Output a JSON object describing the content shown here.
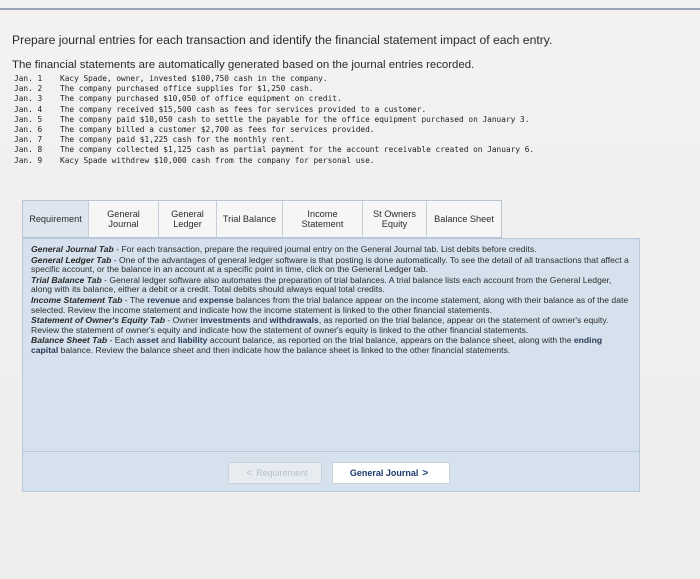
{
  "heading": "Prepare journal entries for each transaction and identify the financial statement impact of each entry.",
  "subheading": "The financial statements are automatically generated based on the journal entries recorded.",
  "transactions": [
    {
      "date": "Jan. 1",
      "text": "Kacy Spade, owner, invested $100,750 cash in the company."
    },
    {
      "date": "Jan. 2",
      "text": "The company purchased office supplies for $1,250 cash."
    },
    {
      "date": "Jan. 3",
      "text": "The company purchased $10,050 of office equipment on credit."
    },
    {
      "date": "Jan. 4",
      "text": "The company received $15,500 cash as fees for services provided to a customer."
    },
    {
      "date": "Jan. 5",
      "text": "The company paid $10,050 cash to settle the payable for the office equipment purchased on January 3."
    },
    {
      "date": "Jan. 6",
      "text": "The company billed a customer $2,700 as fees for services provided."
    },
    {
      "date": "Jan. 7",
      "text": "The company paid $1,225 cash for the monthly rent."
    },
    {
      "date": "Jan. 8",
      "text": "The company collected $1,125 cash as partial payment for the account receivable created on January 6."
    },
    {
      "date": "Jan. 9",
      "text": "Kacy Spade withdrew $10,000 cash from the company for personal use."
    }
  ],
  "tabs": {
    "requirement": "Requirement",
    "general_journal_l1": "General",
    "general_journal_l2": "Journal",
    "general_ledger_l1": "General",
    "general_ledger_l2": "Ledger",
    "trial_balance": "Trial Balance",
    "income_l1": "Income",
    "income_l2": "Statement",
    "owners_l1": "St Owners",
    "owners_l2": "Equity",
    "balance_sheet": "Balance Sheet"
  },
  "info": {
    "gj_title": "General Journal Tab",
    "gj_text": " - For each transaction, prepare the required journal entry on the General Journal tab. List debits before credits.",
    "gl_title": "General Ledger Tab",
    "gl_text": " - One of the advantages of general ledger software is that posting is done automatically. To see the detail of all transactions that affect a specific account, or the balance in an account at a specific point in time, click on the General Ledger tab.",
    "tb_title": "Trial Balance Tab",
    "tb_text": " - General ledger software also automates the preparation of trial balances. A trial balance lists each account from the General Ledger, along with its balance, either a debit or a credit. Total debits should always equal total credits.",
    "is_title": "Income Statement Tab",
    "is_text_a": " - The ",
    "is_kw1": "revenue",
    "is_text_b": " and ",
    "is_kw2": "expense",
    "is_text_c": " balances from the trial balance appear on the income statement, along with their balance as of the date selected. Review the income statement and indicate how the income statement is linked to the other financial statements.",
    "oe_title": "Statement of Owner's Equity Tab",
    "oe_text_a": " - Owner ",
    "oe_kw1": "investments",
    "oe_text_b": " and ",
    "oe_kw2": "withdrawals",
    "oe_text_c": ", as reported on the trial balance, appear on the statement of owner's equity. Review the statement of owner's equity and indicate how the statement of owner's equity is linked to the other financial statements.",
    "bs_title": "Balance Sheet Tab",
    "bs_text_a": " - Each ",
    "bs_kw1": "asset",
    "bs_text_b": " and ",
    "bs_kw2": "liability",
    "bs_text_c": " account balance, as reported on the trial balance, appears on the balance sheet, along with the ",
    "bs_kw3": "ending capital",
    "bs_text_d": " balance. Review the balance sheet and then indicate how the balance sheet is linked to the other financial statements."
  },
  "nav": {
    "prev_label": "Requirement",
    "prev_chevron": "<",
    "next_label": "General Journal",
    "next_chevron": ">"
  },
  "colors": {
    "panel_bg": "#d5e1ec",
    "active_tab": "#dde6ef",
    "next_text": "#1d3a6e"
  }
}
